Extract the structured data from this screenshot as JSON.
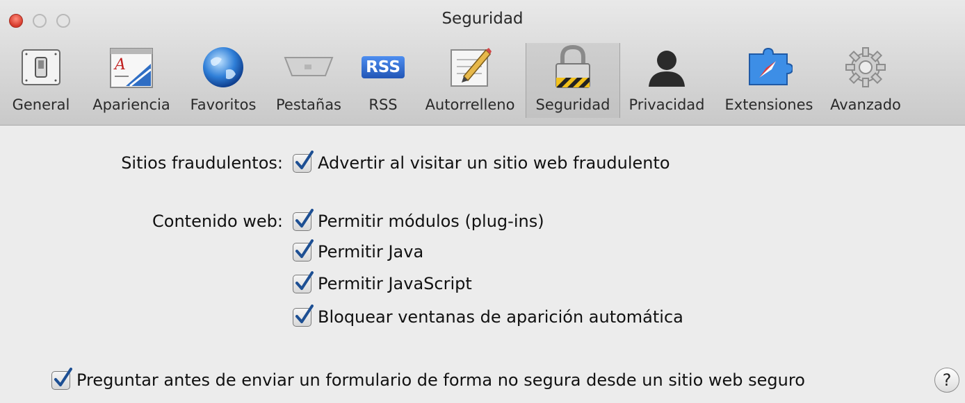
{
  "window": {
    "title": "Seguridad"
  },
  "tabs": [
    {
      "label": "General",
      "icon": "switch-icon"
    },
    {
      "label": "Apariencia",
      "icon": "font-icon"
    },
    {
      "label": "Favoritos",
      "icon": "globe-icon"
    },
    {
      "label": "Pestañas",
      "icon": "tab-icon"
    },
    {
      "label": "RSS",
      "icon": "rss-icon",
      "badge": "RSS"
    },
    {
      "label": "Autorrelleno",
      "icon": "pencil-icon"
    },
    {
      "label": "Seguridad",
      "icon": "lock-icon",
      "active": true
    },
    {
      "label": "Privacidad",
      "icon": "person-icon"
    },
    {
      "label": "Extensiones",
      "icon": "puzzle-icon"
    },
    {
      "label": "Avanzado",
      "icon": "gear-icon"
    }
  ],
  "settings": {
    "fraud": {
      "label": "Sitios fraudulentos:",
      "option": {
        "text": "Advertir al visitar un sitio web fraudulento",
        "checked": true
      }
    },
    "web_content": {
      "label": "Contenido web:",
      "options": [
        {
          "text": "Permitir módulos (plug-ins)",
          "checked": true
        },
        {
          "text": "Permitir Java",
          "checked": true
        },
        {
          "text": "Permitir JavaScript",
          "checked": true
        },
        {
          "text": "Bloquear ventanas de aparición automática",
          "checked": true
        }
      ]
    },
    "form_warning": {
      "text": "Preguntar antes de enviar un formulario de forma no segura desde un sitio web seguro",
      "checked": true
    }
  },
  "help_button": {
    "label": "?"
  },
  "colors": {
    "close": "#e0443a",
    "accent_check": "#1d4f93",
    "rss_badge": "#2d6fd1"
  }
}
